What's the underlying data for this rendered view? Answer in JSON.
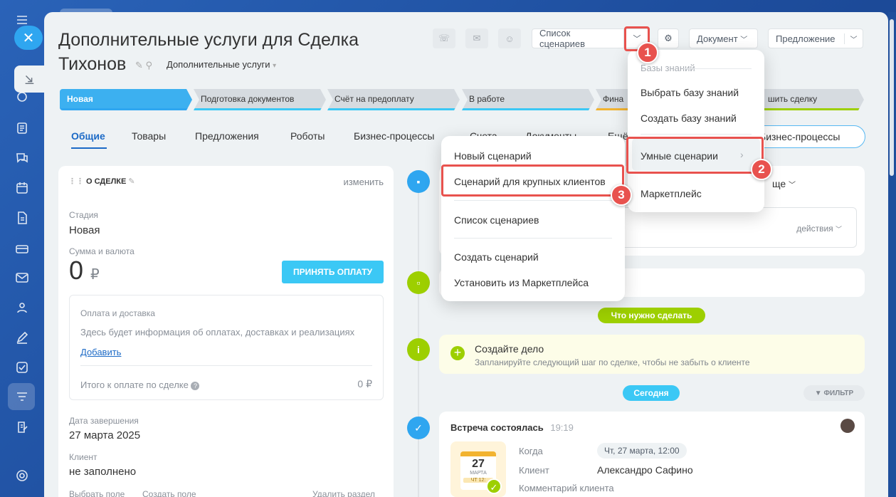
{
  "header": {
    "title": "Дополнительные услуги для Сделка Тихонов",
    "funnel": "Дополнительные услуги"
  },
  "toolbar": {
    "scenarios": "Список сценариев",
    "document": "Документ",
    "offer": "Предложение"
  },
  "stages": [
    "Новая",
    "Подготовка документов",
    "Счёт на предоплату",
    "В работе",
    "Фина",
    "шить сделку"
  ],
  "tabs": [
    "Общие",
    "Товары",
    "Предложения",
    "Роботы",
    "Бизнес-процессы",
    "Счета",
    "Документы",
    "Ещё"
  ],
  "bp_pill": "Бизнес-процессы",
  "deal": {
    "section": "О СДЕЛКЕ",
    "edit": "изменить",
    "stage_label": "Стадия",
    "stage_value": "Новая",
    "sum_label": "Сумма и валюта",
    "sum_value": "0",
    "currency": "₽",
    "pay_button": "ПРИНЯТЬ ОПЛАТУ",
    "payment_title": "Оплата и доставка",
    "payment_text": "Здесь будет информация об оплатах, доставках и реализациях",
    "add_link": "Добавить",
    "total_label": "Итого к оплате по сделке",
    "total_value": "0 ₽",
    "end_label": "Дата завершения",
    "end_value": "27 марта 2025",
    "client_label": "Клиент",
    "client_value": "не заполнено",
    "select_field": "Выбрать поле",
    "create_field": "Создать поле",
    "delete_section": "Удалить раздел"
  },
  "feed": {
    "tab_more": "ще",
    "actions": "действия",
    "todo_pill": "Что нужно сделать",
    "create_title": "Создайте дело",
    "create_text": "Запланируйте следующий шаг по сделке, чтобы не забыть о клиенте",
    "today_pill": "Сегодня",
    "filter": "ФИЛЬТР",
    "meeting_title": "Встреча состоялась",
    "meeting_time": "19:19",
    "cal_day": "27",
    "cal_month": "МАРТА",
    "cal_time": "ЧТ 12:",
    "when_label": "Когда",
    "when_value": "Чт, 27 марта, 12:00",
    "client_label": "Клиент",
    "client_value": "Александро Сафино",
    "comment_label": "Комментарий клиента"
  },
  "menu_main": {
    "kb_header": "Базы знаний",
    "choose_kb": "Выбрать базу знаний",
    "create_kb": "Создать базу знаний",
    "smart": "Умные сценарии",
    "market": "Маркетплейс"
  },
  "menu_sub": {
    "new": "Новый сценарий",
    "big_clients": "Сценарий для крупных клиентов",
    "list": "Список сценариев",
    "create": "Создать сценарий",
    "install": "Установить из Маркетплейса"
  },
  "badges": [
    "1",
    "2",
    "3"
  ],
  "colors": {
    "accent": "#3bc8f5",
    "marker": "#e8524e",
    "green": "#9dcf00"
  }
}
